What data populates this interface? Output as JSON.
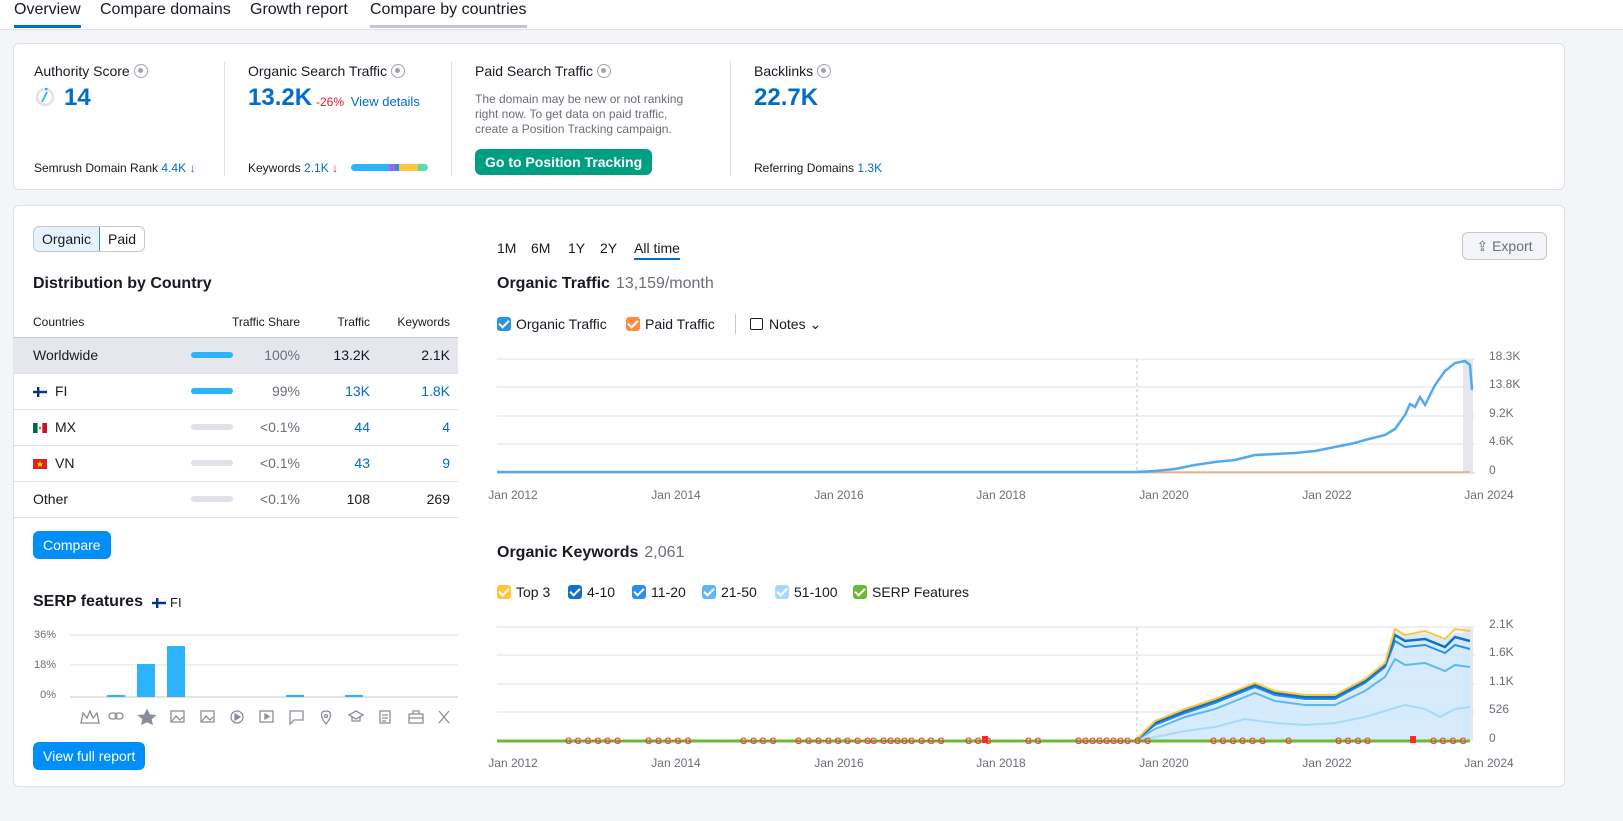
{
  "tabs": [
    "Overview",
    "Compare domains",
    "Growth report",
    "Compare by countries"
  ],
  "summary": {
    "authority": {
      "title": "Authority Score",
      "value": "14",
      "rank_label": "Semrush Domain Rank",
      "rank_value": "4.4K"
    },
    "organic": {
      "title": "Organic Search Traffic",
      "value": "13.2K",
      "change": "-26%",
      "link": "View details",
      "kw_label": "Keywords",
      "kw_value": "2.1K"
    },
    "paid": {
      "title": "Paid Search Traffic",
      "desc1": "The domain may be new or not ranking",
      "desc2": "right now. To get data on paid traffic,",
      "desc3": "create a Position Tracking campaign.",
      "button": "Go to Position Tracking"
    },
    "backlinks": {
      "title": "Backlinks",
      "value": "22.7K",
      "ref_label": "Referring Domains",
      "ref_value": "1.3K"
    }
  },
  "toggle": {
    "organic": "Organic",
    "paid": "Paid"
  },
  "distribution": {
    "title": "Distribution by Country",
    "headers": [
      "Countries",
      "Traffic Share",
      "Traffic",
      "Keywords"
    ],
    "rows": [
      {
        "country": "Worldwide",
        "share": "100%",
        "share_pct": 100,
        "traffic": "13.2K",
        "keywords": "2.1K"
      },
      {
        "country": "FI",
        "share": "99%",
        "share_pct": 99,
        "traffic": "13K",
        "keywords": "1.8K"
      },
      {
        "country": "MX",
        "share": "<0.1%",
        "share_pct": 0,
        "traffic": "44",
        "keywords": "4"
      },
      {
        "country": "VN",
        "share": "<0.1%",
        "share_pct": 0,
        "traffic": "43",
        "keywords": "9"
      },
      {
        "country": "Other",
        "share": "<0.1%",
        "share_pct": 0,
        "traffic": "108",
        "keywords": "269"
      }
    ],
    "compare_button": "Compare"
  },
  "serp": {
    "title": "SERP features",
    "country": "FI",
    "yticks": [
      "36%",
      "18%",
      "0%"
    ],
    "button": "View full report",
    "icons": [
      "crown-icon",
      "link-icon",
      "star-icon",
      "image-icon",
      "gallery-icon",
      "video-icon",
      "video-box-icon",
      "faq-icon",
      "location-icon",
      "graduation-icon",
      "document-icon",
      "briefcase-icon",
      "x-icon"
    ]
  },
  "periods": [
    "1M",
    "6M",
    "1Y",
    "2Y",
    "All time"
  ],
  "export": "Export",
  "traffic_chart": {
    "title": "Organic Traffic",
    "subtitle": "13,159/month",
    "legend": [
      "Organic Traffic",
      "Paid Traffic"
    ],
    "notes": "Notes",
    "yticks": [
      "18.3K",
      "13.8K",
      "9.2K",
      "4.6K",
      "0"
    ],
    "xticks": [
      "Jan 2012",
      "Jan 2014",
      "Jan 2016",
      "Jan 2018",
      "Jan 2020",
      "Jan 2022",
      "Jan 2024"
    ]
  },
  "keywords_chart": {
    "title": "Organic Keywords",
    "subtitle": "2,061",
    "legend": [
      "Top 3",
      "4-10",
      "11-20",
      "21-50",
      "51-100",
      "SERP Features"
    ],
    "yticks": [
      "2.1K",
      "1.6K",
      "1.1K",
      "526",
      "0"
    ],
    "xticks": [
      "Jan 2012",
      "Jan 2014",
      "Jan 2016",
      "Jan 2018",
      "Jan 2020",
      "Jan 2022",
      "Jan 2024"
    ]
  },
  "colors": {
    "accent": "#006dca",
    "green": "#009f81",
    "organic": "#52a9ec",
    "paid": "#ff8c43",
    "top3": "#ffc53d",
    "kw410": "#1071c9",
    "kw1120": "#2b8ee8",
    "kw2150": "#5db8f5",
    "kw51100": "#a7d9fb",
    "serp": "#6cb938"
  }
}
